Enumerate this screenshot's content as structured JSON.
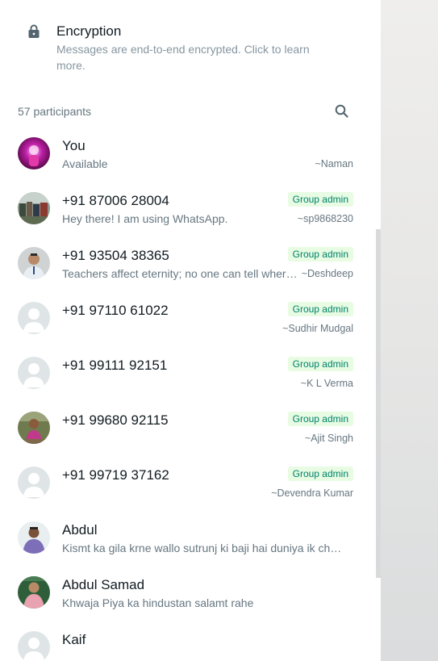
{
  "encryption": {
    "icon": "lock-icon",
    "title": "Encryption",
    "description": "Messages are end-to-end encrypted. Click to learn more."
  },
  "participants": {
    "count_label": "57 participants",
    "search_icon": "search-icon",
    "items": [
      {
        "name": "You",
        "status": "Available",
        "badge": "",
        "pushname": "~Naman",
        "avatar": "photo-magenta"
      },
      {
        "name": "+91 87006 28004",
        "status": "Hey there! I am using WhatsApp.",
        "badge": "Group admin",
        "pushname": "~sp9868230",
        "avatar": "photo-group"
      },
      {
        "name": "+91 93504 38365",
        "status": "Teachers affect eternity; no one can tell where…",
        "badge": "Group admin",
        "pushname": "~Deshdeep",
        "avatar": "photo-man"
      },
      {
        "name": "+91 97110 61022",
        "status": "",
        "badge": "Group admin",
        "pushname": "~Sudhir Mudgal",
        "avatar": "default"
      },
      {
        "name": "+91 99111 92151",
        "status": "",
        "badge": "Group admin",
        "pushname": "~K L Verma",
        "avatar": "default"
      },
      {
        "name": "+91 99680 92115",
        "status": "",
        "badge": "Group admin",
        "pushname": "~Ajit Singh",
        "avatar": "photo-outdoor"
      },
      {
        "name": "+91 99719 37162",
        "status": "",
        "badge": "Group admin",
        "pushname": "~Devendra Kumar",
        "avatar": "default"
      },
      {
        "name": "Abdul",
        "status": "Kismt ka gila krne wallo sutrunj ki baji hai duniya ik cha…",
        "badge": "",
        "pushname": "",
        "avatar": "photo-man2"
      },
      {
        "name": "Abdul Samad",
        "status": "Khwaja Piya ka hindustan salamt rahe",
        "badge": "",
        "pushname": "",
        "avatar": "photo-pink"
      },
      {
        "name": "Kaif",
        "status": "",
        "badge": "",
        "pushname": "",
        "avatar": "default"
      }
    ]
  },
  "colors": {
    "admin_badge_bg": "#e7fce3",
    "admin_badge_text": "#008069",
    "primary_text": "#111b21",
    "secondary_text": "#667781"
  }
}
